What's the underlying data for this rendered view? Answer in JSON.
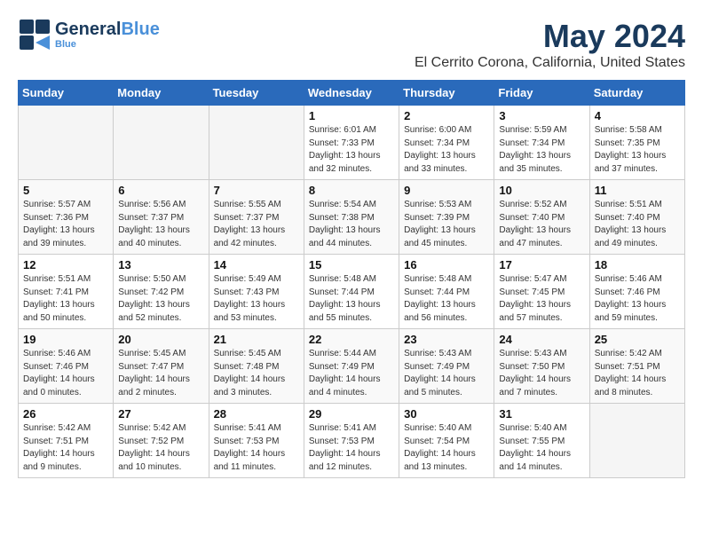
{
  "logo": {
    "line1": "General",
    "line2": "Blue",
    "tagline": "Blue"
  },
  "title": "May 2024",
  "subtitle": "El Cerrito Corona, California, United States",
  "days_of_week": [
    "Sunday",
    "Monday",
    "Tuesday",
    "Wednesday",
    "Thursday",
    "Friday",
    "Saturday"
  ],
  "weeks": [
    [
      {
        "day": "",
        "info": ""
      },
      {
        "day": "",
        "info": ""
      },
      {
        "day": "",
        "info": ""
      },
      {
        "day": "1",
        "info": "Sunrise: 6:01 AM\nSunset: 7:33 PM\nDaylight: 13 hours\nand 32 minutes."
      },
      {
        "day": "2",
        "info": "Sunrise: 6:00 AM\nSunset: 7:34 PM\nDaylight: 13 hours\nand 33 minutes."
      },
      {
        "day": "3",
        "info": "Sunrise: 5:59 AM\nSunset: 7:34 PM\nDaylight: 13 hours\nand 35 minutes."
      },
      {
        "day": "4",
        "info": "Sunrise: 5:58 AM\nSunset: 7:35 PM\nDaylight: 13 hours\nand 37 minutes."
      }
    ],
    [
      {
        "day": "5",
        "info": "Sunrise: 5:57 AM\nSunset: 7:36 PM\nDaylight: 13 hours\nand 39 minutes."
      },
      {
        "day": "6",
        "info": "Sunrise: 5:56 AM\nSunset: 7:37 PM\nDaylight: 13 hours\nand 40 minutes."
      },
      {
        "day": "7",
        "info": "Sunrise: 5:55 AM\nSunset: 7:37 PM\nDaylight: 13 hours\nand 42 minutes."
      },
      {
        "day": "8",
        "info": "Sunrise: 5:54 AM\nSunset: 7:38 PM\nDaylight: 13 hours\nand 44 minutes."
      },
      {
        "day": "9",
        "info": "Sunrise: 5:53 AM\nSunset: 7:39 PM\nDaylight: 13 hours\nand 45 minutes."
      },
      {
        "day": "10",
        "info": "Sunrise: 5:52 AM\nSunset: 7:40 PM\nDaylight: 13 hours\nand 47 minutes."
      },
      {
        "day": "11",
        "info": "Sunrise: 5:51 AM\nSunset: 7:40 PM\nDaylight: 13 hours\nand 49 minutes."
      }
    ],
    [
      {
        "day": "12",
        "info": "Sunrise: 5:51 AM\nSunset: 7:41 PM\nDaylight: 13 hours\nand 50 minutes."
      },
      {
        "day": "13",
        "info": "Sunrise: 5:50 AM\nSunset: 7:42 PM\nDaylight: 13 hours\nand 52 minutes."
      },
      {
        "day": "14",
        "info": "Sunrise: 5:49 AM\nSunset: 7:43 PM\nDaylight: 13 hours\nand 53 minutes."
      },
      {
        "day": "15",
        "info": "Sunrise: 5:48 AM\nSunset: 7:44 PM\nDaylight: 13 hours\nand 55 minutes."
      },
      {
        "day": "16",
        "info": "Sunrise: 5:48 AM\nSunset: 7:44 PM\nDaylight: 13 hours\nand 56 minutes."
      },
      {
        "day": "17",
        "info": "Sunrise: 5:47 AM\nSunset: 7:45 PM\nDaylight: 13 hours\nand 57 minutes."
      },
      {
        "day": "18",
        "info": "Sunrise: 5:46 AM\nSunset: 7:46 PM\nDaylight: 13 hours\nand 59 minutes."
      }
    ],
    [
      {
        "day": "19",
        "info": "Sunrise: 5:46 AM\nSunset: 7:46 PM\nDaylight: 14 hours\nand 0 minutes."
      },
      {
        "day": "20",
        "info": "Sunrise: 5:45 AM\nSunset: 7:47 PM\nDaylight: 14 hours\nand 2 minutes."
      },
      {
        "day": "21",
        "info": "Sunrise: 5:45 AM\nSunset: 7:48 PM\nDaylight: 14 hours\nand 3 minutes."
      },
      {
        "day": "22",
        "info": "Sunrise: 5:44 AM\nSunset: 7:49 PM\nDaylight: 14 hours\nand 4 minutes."
      },
      {
        "day": "23",
        "info": "Sunrise: 5:43 AM\nSunset: 7:49 PM\nDaylight: 14 hours\nand 5 minutes."
      },
      {
        "day": "24",
        "info": "Sunrise: 5:43 AM\nSunset: 7:50 PM\nDaylight: 14 hours\nand 7 minutes."
      },
      {
        "day": "25",
        "info": "Sunrise: 5:42 AM\nSunset: 7:51 PM\nDaylight: 14 hours\nand 8 minutes."
      }
    ],
    [
      {
        "day": "26",
        "info": "Sunrise: 5:42 AM\nSunset: 7:51 PM\nDaylight: 14 hours\nand 9 minutes."
      },
      {
        "day": "27",
        "info": "Sunrise: 5:42 AM\nSunset: 7:52 PM\nDaylight: 14 hours\nand 10 minutes."
      },
      {
        "day": "28",
        "info": "Sunrise: 5:41 AM\nSunset: 7:53 PM\nDaylight: 14 hours\nand 11 minutes."
      },
      {
        "day": "29",
        "info": "Sunrise: 5:41 AM\nSunset: 7:53 PM\nDaylight: 14 hours\nand 12 minutes."
      },
      {
        "day": "30",
        "info": "Sunrise: 5:40 AM\nSunset: 7:54 PM\nDaylight: 14 hours\nand 13 minutes."
      },
      {
        "day": "31",
        "info": "Sunrise: 5:40 AM\nSunset: 7:55 PM\nDaylight: 14 hours\nand 14 minutes."
      },
      {
        "day": "",
        "info": ""
      }
    ]
  ]
}
